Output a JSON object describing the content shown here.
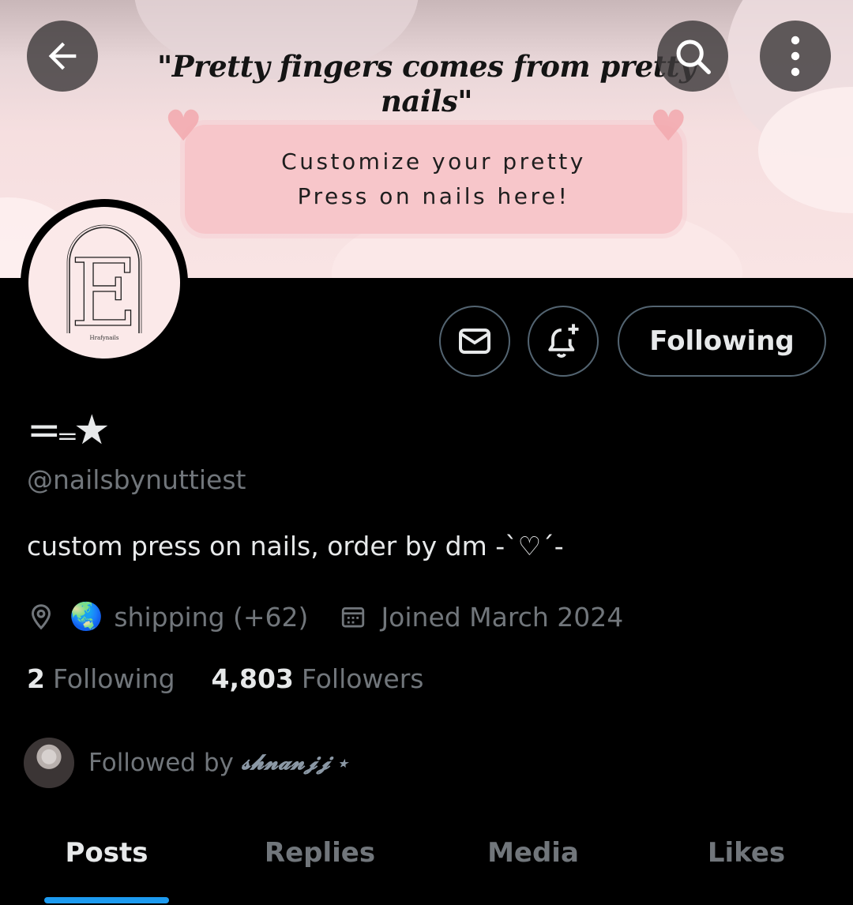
{
  "banner": {
    "quote": "\"Pretty fingers comes from pretty nails\"",
    "promo_line1": "Customize your pretty",
    "promo_line2": "Press on nails here!"
  },
  "top_bar": {
    "back_icon": "arrow-left-icon",
    "search_icon": "search-icon",
    "more_icon": "more-vertical-icon"
  },
  "avatar": {
    "monogram": "E",
    "caption": "Hrafynails"
  },
  "actions": {
    "message_icon": "envelope-icon",
    "notify_icon": "bell-plus-icon",
    "follow_label": "Following"
  },
  "profile": {
    "display_name": "=₌★",
    "handle": "@nailsbynuttiest",
    "bio": "custom press on nails, order by dm -`♡´-",
    "location_icon": "location-pin-icon",
    "location_emoji": "🌏",
    "location": "shipping (+62)",
    "joined_icon": "calendar-icon",
    "joined": "Joined March 2024"
  },
  "stats": {
    "following_count": "2",
    "following_label": "Following",
    "followers_count": "4,803",
    "followers_label": "Followers"
  },
  "followed_by": {
    "text": "Followed by",
    "name": "𝓼𝓱𝓷𝓪𝓷𝓳𝓳 ⋆"
  },
  "tabs": [
    {
      "label": "Posts"
    },
    {
      "label": "Replies"
    },
    {
      "label": "Media"
    },
    {
      "label": "Likes"
    }
  ],
  "colors": {
    "accent": "#1d9bf0",
    "background": "#000000",
    "primary_text": "#e7e9ea",
    "secondary_text": "#71767b",
    "border": "#536471",
    "banner_pink": "#f7c6ca"
  }
}
